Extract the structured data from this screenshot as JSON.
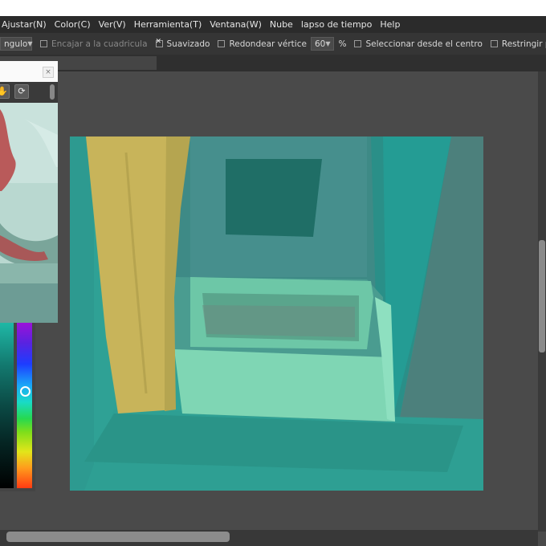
{
  "menu": [
    {
      "label": "Ajustar(N)"
    },
    {
      "label": "Color(C)"
    },
    {
      "label": "Ver(V)"
    },
    {
      "label": "Herramienta(T)"
    },
    {
      "label": "Ventana(W)"
    },
    {
      "label": "Nube"
    },
    {
      "label": "lapso de tiempo"
    },
    {
      "label": "Help"
    }
  ],
  "toolbar": {
    "shape_dropdown": "ngulo",
    "snap_grid_label": "Encajar a la cuadricula",
    "snap_grid_checked": false,
    "smooth_label": "Suavizado",
    "smooth_checked": true,
    "round_corner_label": "Redondear vértice",
    "round_corner_checked": false,
    "round_value": "60",
    "percent_label": "%",
    "select_center_label": "Seleccionar desde el centro",
    "select_center_checked": false,
    "restrict_label": "Restringir proporcion",
    "restrict_checked": false
  },
  "panel": {
    "close_glyph": "×"
  },
  "colors": {
    "menubar": "#2b2b2b",
    "toolbar": "#353535",
    "workspace": "#4a4a4a",
    "canvas_teal": "#2fa195",
    "curtain": "#c8b45a"
  }
}
